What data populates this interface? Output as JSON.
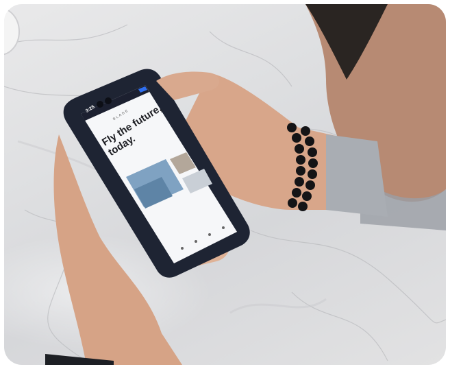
{
  "photo": {
    "subject": "hands holding smartphone over marble table",
    "colors": {
      "marble": "#dcdde0",
      "phone_body": "#1e2433",
      "skin": "#d9a98e",
      "bracelet": "#141416"
    }
  },
  "screen": {
    "clock": "3:25",
    "brand": "BLADE",
    "headline_line1": "Fly the future,",
    "headline_line2": "today."
  }
}
